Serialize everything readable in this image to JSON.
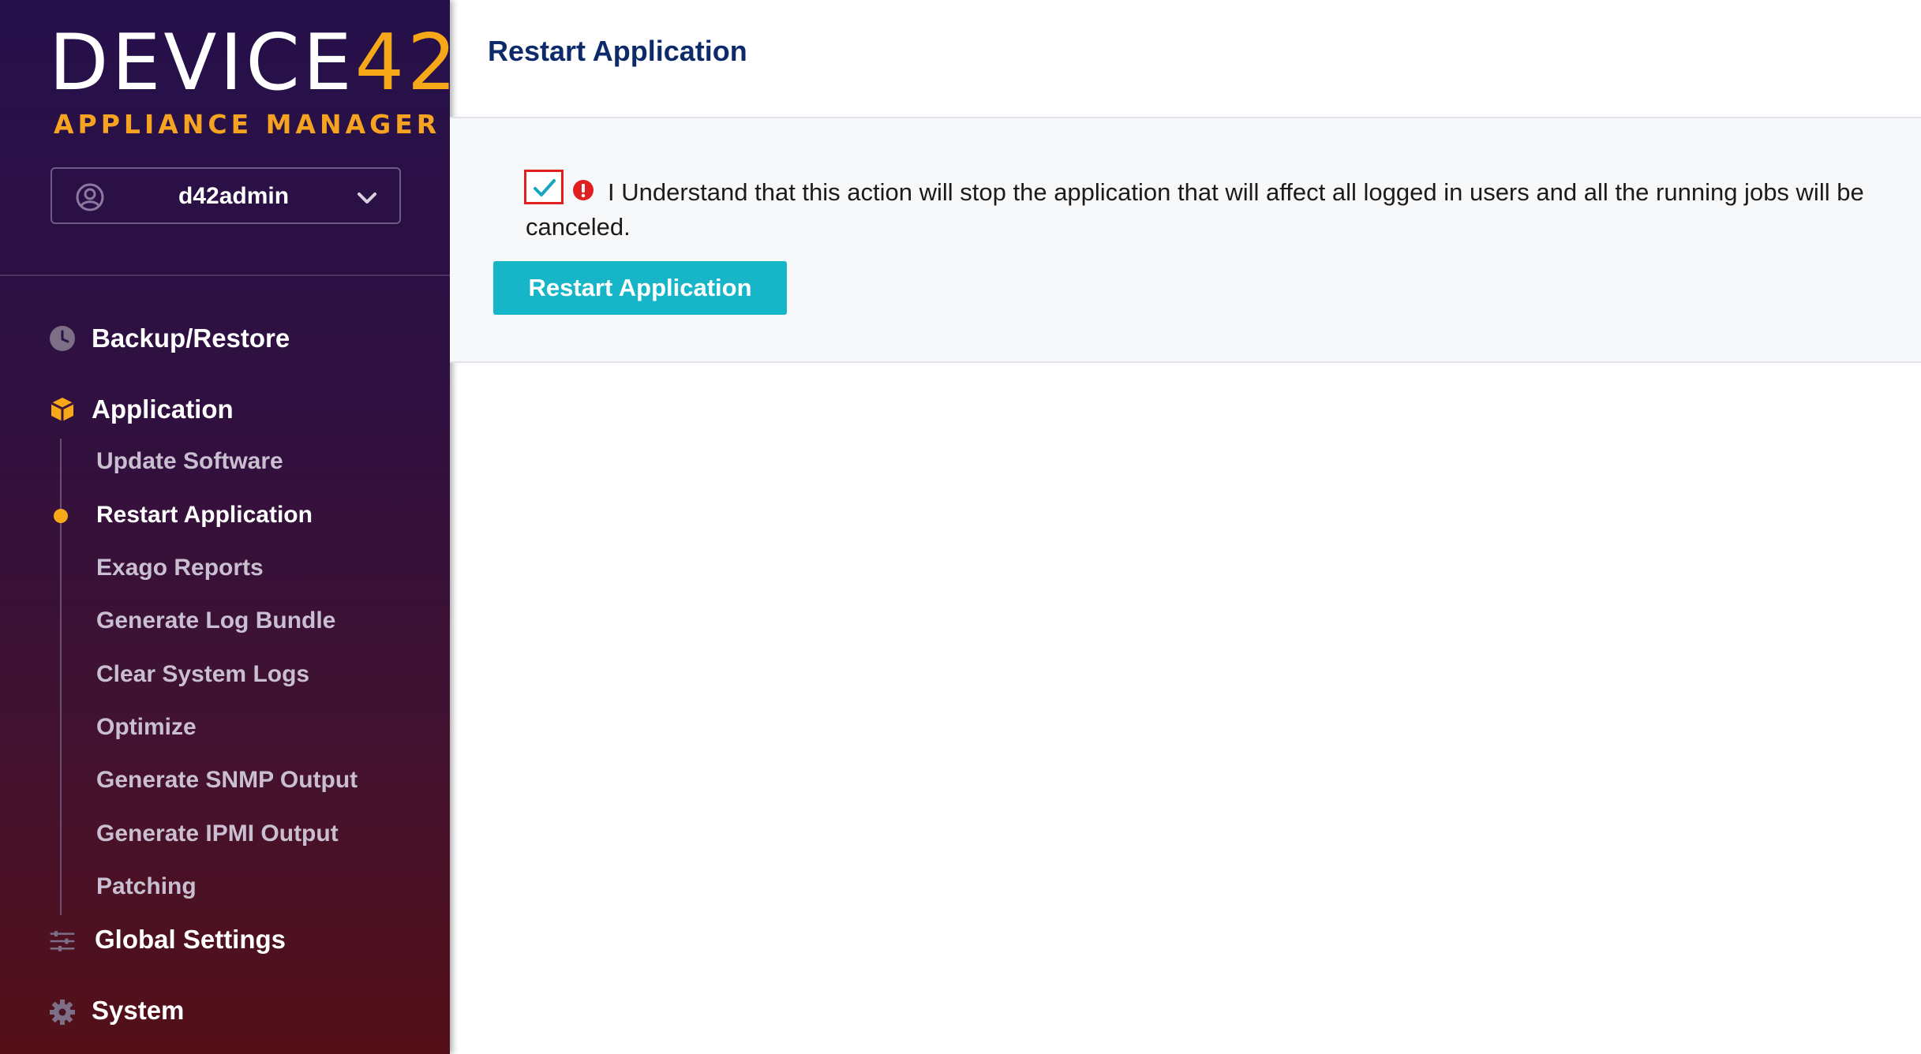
{
  "brand": {
    "name_prefix": "DEVICE",
    "name_suffix": "42",
    "subtitle": "APPLIANCE MANAGER"
  },
  "user": {
    "name": "d42admin"
  },
  "nav": {
    "backup": "Backup/Restore",
    "application": "Application",
    "sub_items": [
      "Update Software",
      "Restart Application",
      "Exago Reports",
      "Generate Log Bundle",
      "Clear System Logs",
      "Optimize",
      "Generate SNMP Output",
      "Generate IPMI Output",
      "Patching"
    ],
    "global_settings": "Global Settings",
    "system": "System"
  },
  "page": {
    "title": "Restart Application",
    "confirm_text": "I Understand that this action will stop the application that will affect all logged in users and all the running jobs will be canceled.",
    "confirm_checked": true,
    "button_label": "Restart Application"
  },
  "colors": {
    "accent": "#f7a818",
    "button": "#17b5c8",
    "title": "#0d2a6b",
    "warning": "#e02020"
  }
}
